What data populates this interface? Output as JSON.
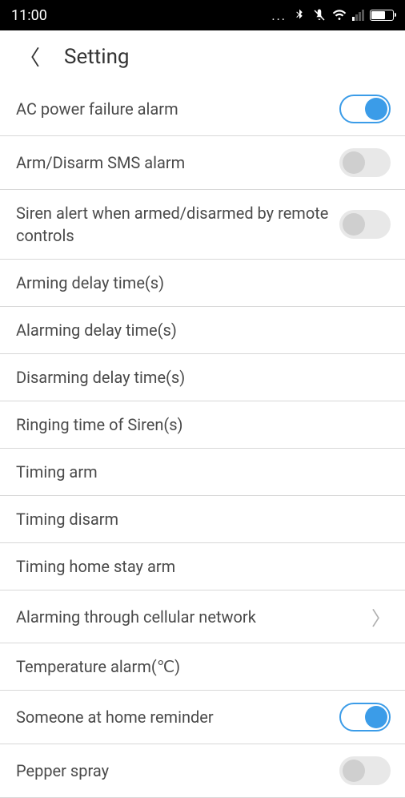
{
  "statusBar": {
    "time": "11:00",
    "dots": "..."
  },
  "header": {
    "title": "Setting"
  },
  "settings": {
    "acPowerFailure": "AC power failure alarm",
    "armDisarmSms": "Arm/Disarm SMS alarm",
    "sirenAlert": "Siren alert when armed/disarmed by remote controls",
    "armingDelay": "Arming delay time(s)",
    "alarmingDelay": "Alarming delay time(s)",
    "disarmingDelay": "Disarming delay time(s)",
    "ringingTime": "Ringing time of Siren(s)",
    "timingArm": "Timing arm",
    "timingDisarm": "Timing disarm",
    "timingHomeStay": "Timing home stay arm",
    "alarmingCellular": "Alarming through cellular network",
    "temperatureAlarm": "Temperature alarm(℃)",
    "someoneHome": "Someone at home reminder",
    "pepperSpray": "Pepper spray"
  },
  "toggleStates": {
    "acPowerFailure": true,
    "armDisarmSms": false,
    "sirenAlert": false,
    "someoneHome": true,
    "pepperSpray": false
  }
}
